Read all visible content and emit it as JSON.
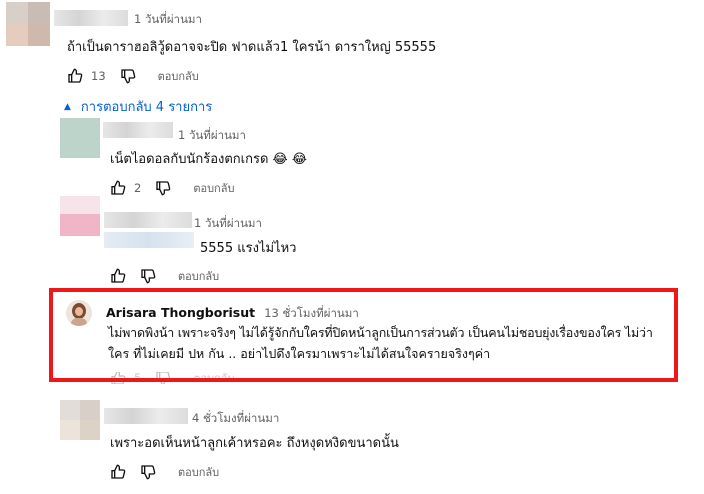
{
  "colors": {
    "highlight_border": "#ef1717",
    "link": "#065fd4",
    "secondary_text": "#606060"
  },
  "comments": [
    {
      "time": "1 วันที่ผ่านมา",
      "text": "ถ้าเป็นดาราฮอลิวู้ดอาจจะปิด ฟาดแล้ว1 ใครน้า ดาราใหญ่ 55555",
      "likes": "13",
      "reply_label": "ตอบกลับ"
    }
  ],
  "replies_toggle": {
    "label": "การตอบกลับ 4 รายการ",
    "icon": "caret-up-icon"
  },
  "replies": [
    {
      "time": "1 วันที่ผ่านมา",
      "text": "เน็ตไอดอลกับนักร้องตกเกรด 😂 😂",
      "likes": "2",
      "reply_label": "ตอบกลับ"
    },
    {
      "time": "1 วันที่ผ่านมา",
      "text": "5555 แรงไม่ไหว",
      "likes": "",
      "reply_label": "ตอบกลับ"
    },
    {
      "author": "Arisara Thongborisut",
      "time": "13 ชั่วโมงที่ผ่านมา",
      "text_line1": "ไม่พาดพิงน้า เพราะจริงๆ ไม่ได้รู้จักกับใครที่ปิดหน้าลูกเป็นการส่วนตัว เป็นคนไม่ชอบยุ่งเรื่องของใคร ไม่ว่า",
      "text_line2": "ใคร ที่ไม่เคยมี ปห กัน .. อย่าไปดึงใครมาเพราะไม่ได้สนใจครายจริงๆค่า",
      "likes": "5",
      "reply_label": "ตอบกลับ",
      "highlighted": true
    },
    {
      "time": "4 ชั่วโมงที่ผ่านมา",
      "text": "เพราะอดเห็นหน้าลูกเค้าหรอคะ ถึงหงุดหงิดขนาดนั้น",
      "likes": "",
      "reply_label": "ตอบกลับ"
    }
  ]
}
